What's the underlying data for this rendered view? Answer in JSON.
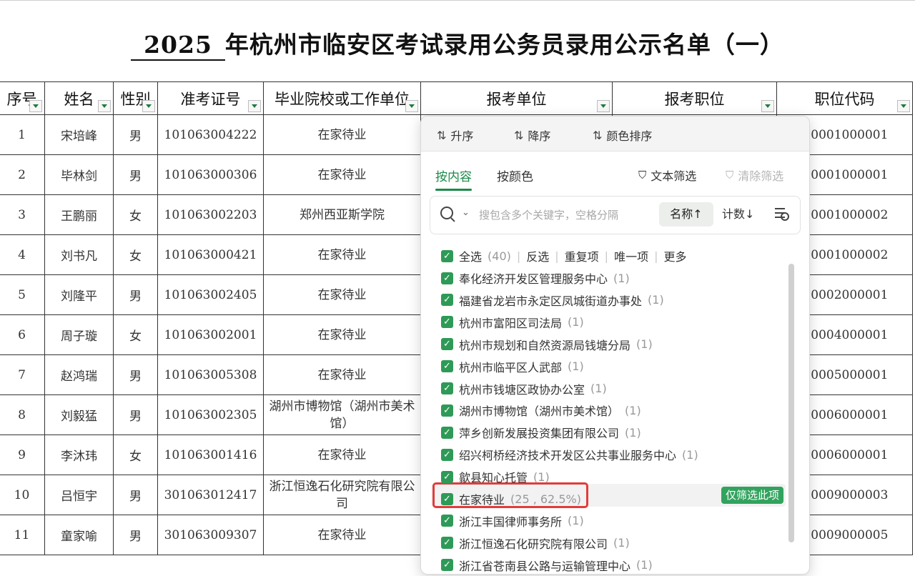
{
  "title": {
    "year": "2025",
    "rest": "年杭州市临安区考试录用公务员录用公示名单（一）"
  },
  "headers": [
    "序号",
    "姓名",
    "性别",
    "准考证号",
    "毕业院校或工作单位",
    "报考单位",
    "报考职位",
    "职位代码"
  ],
  "rows": [
    {
      "no": "1",
      "name": "宋培峰",
      "gender": "男",
      "exam_id": "101063004222",
      "school": "在家待业",
      "code": "01010001000001"
    },
    {
      "no": "2",
      "name": "毕林剑",
      "gender": "男",
      "exam_id": "101063000306",
      "school": "在家待业",
      "code": "01010001000001"
    },
    {
      "no": "3",
      "name": "王鹏丽",
      "gender": "女",
      "exam_id": "101063002203",
      "school": "郑州西亚斯学院",
      "code": "01010001000002"
    },
    {
      "no": "4",
      "name": "刘书凡",
      "gender": "女",
      "exam_id": "101063000421",
      "school": "在家待业",
      "code": "01010001000002"
    },
    {
      "no": "5",
      "name": "刘隆平",
      "gender": "男",
      "exam_id": "101063002405",
      "school": "在家待业",
      "code": "01010002000001"
    },
    {
      "no": "6",
      "name": "周子璇",
      "gender": "女",
      "exam_id": "101063002001",
      "school": "在家待业",
      "code": "01010004000001"
    },
    {
      "no": "7",
      "name": "赵鸿瑞",
      "gender": "男",
      "exam_id": "101063005308",
      "school": "在家待业",
      "code": "01010005000001"
    },
    {
      "no": "8",
      "name": "刘毅猛",
      "gender": "男",
      "exam_id": "101063002305",
      "school": "湖州市博物馆（湖州市美术馆）",
      "code": "01010006000001"
    },
    {
      "no": "9",
      "name": "李沐玮",
      "gender": "女",
      "exam_id": "101063001416",
      "school": "在家待业",
      "code": "01010006000001"
    },
    {
      "no": "10",
      "name": "吕恒宇",
      "gender": "男",
      "exam_id": "301063012417",
      "school": "浙江恒逸石化研究院有限公司",
      "code": "01010009000003"
    },
    {
      "no": "11",
      "name": "童家喻",
      "gender": "男",
      "exam_id": "301063009307",
      "school": "在家待业",
      "code": "01010009000005"
    }
  ],
  "popup": {
    "sort_asc": "升序",
    "sort_desc": "降序",
    "sort_color": "颜色排序",
    "tab_content": "按内容",
    "tab_color": "按颜色",
    "text_filter": "文本筛选",
    "clear_filter": "清除筛选",
    "search_placeholder": "搜包含多个关键字，空格分隔",
    "sort_name": "名称↑",
    "sort_count": "计数↓",
    "select_all": "全选",
    "select_all_count": "(40)",
    "invert": "反选",
    "duplicates": "重复项",
    "unique": "唯一项",
    "more": "更多",
    "only_filter": "仅筛选此项",
    "items": [
      {
        "label": "奉化经济开发区管理服务中心",
        "count": "(1)"
      },
      {
        "label": "福建省龙岩市永定区凤城街道办事处",
        "count": "(1)"
      },
      {
        "label": "杭州市富阳区司法局",
        "count": "(1)"
      },
      {
        "label": "杭州市规划和自然资源局钱塘分局",
        "count": "(1)"
      },
      {
        "label": "杭州市临平区人武部",
        "count": "(1)"
      },
      {
        "label": "杭州市钱塘区政协办公室",
        "count": "(1)"
      },
      {
        "label": "湖州市博物馆（湖州市美术馆）",
        "count": "(1)"
      },
      {
        "label": "萍乡创新发展投资集团有限公司",
        "count": "(1)"
      },
      {
        "label": "绍兴柯桥经济技术开发区公共事业服务中心",
        "count": "(1)"
      },
      {
        "label": "歙县知心托管",
        "count": "(1)"
      },
      {
        "label": "在家待业",
        "count": "(25 , 62.5%)"
      },
      {
        "label": "浙江丰国律师事务所",
        "count": "(1)"
      },
      {
        "label": "浙江恒逸石化研究院有限公司",
        "count": "(1)"
      },
      {
        "label": "浙江省苍南县公路与运输管理中心",
        "count": "(1)"
      }
    ]
  }
}
